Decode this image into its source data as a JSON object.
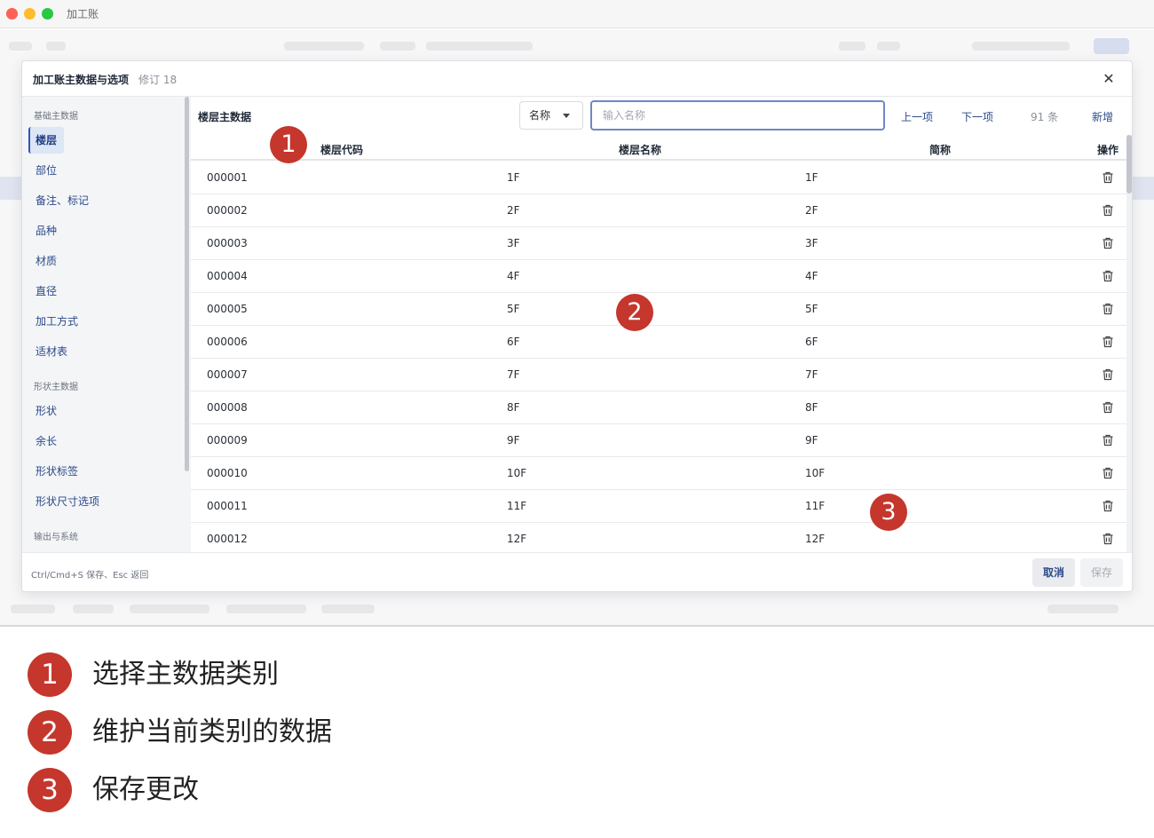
{
  "window": {
    "title": "加工账"
  },
  "modal": {
    "title": "加工账主数据与选项",
    "revision": "修订 18",
    "close_glyph": "✕"
  },
  "sidebar": {
    "groups": [
      {
        "label": "基础主数据",
        "items": [
          "楼层",
          "部位",
          "备注、标记",
          "品种",
          "材质",
          "直径",
          "加工方式",
          "适材表"
        ]
      },
      {
        "label": "形状主数据",
        "items": [
          "形状",
          "余长",
          "形状标签",
          "形状尺寸选项"
        ]
      },
      {
        "label": "输出与系统",
        "items": []
      }
    ],
    "active_item": "楼层"
  },
  "toolbar": {
    "section_title": "楼层主数据",
    "field_select_value": "名称",
    "search_placeholder": "输入名称",
    "prev_label": "上一项",
    "next_label": "下一项",
    "count": "91 条",
    "add_label": "新增"
  },
  "table": {
    "columns": [
      "楼层代码",
      "楼层名称",
      "简称",
      "操作"
    ],
    "rows": [
      [
        "000001",
        "1F",
        "1F"
      ],
      [
        "000002",
        "2F",
        "2F"
      ],
      [
        "000003",
        "3F",
        "3F"
      ],
      [
        "000004",
        "4F",
        "4F"
      ],
      [
        "000005",
        "5F",
        "5F"
      ],
      [
        "000006",
        "6F",
        "6F"
      ],
      [
        "000007",
        "7F",
        "7F"
      ],
      [
        "000008",
        "8F",
        "8F"
      ],
      [
        "000009",
        "9F",
        "9F"
      ],
      [
        "000010",
        "10F",
        "10F"
      ],
      [
        "000011",
        "11F",
        "11F"
      ],
      [
        "000012",
        "12F",
        "12F"
      ]
    ],
    "row_action_icon": "trash-icon"
  },
  "footer": {
    "hint": "Ctrl/Cmd+S 保存、Esc 返回",
    "cancel_label": "取消",
    "save_label": "保存"
  },
  "annotations": {
    "markers": [
      "1",
      "2",
      "3"
    ],
    "legend": [
      {
        "number": "1",
        "text": "选择主数据类别"
      },
      {
        "number": "2",
        "text": "维护当前类别的数据"
      },
      {
        "number": "3",
        "text": "保存更改"
      }
    ]
  },
  "colors": {
    "marker": "#c5362c",
    "accent": "#2f57b3",
    "link": "#2b4a8a",
    "sidebar_bg": "#f4f5f7"
  }
}
